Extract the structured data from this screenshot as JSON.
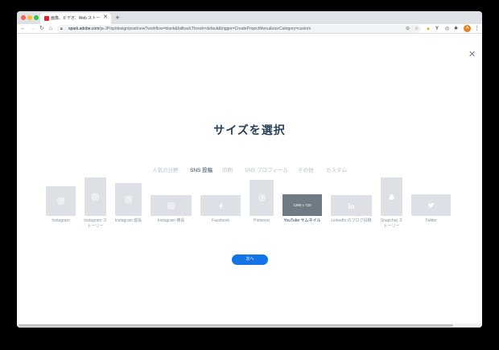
{
  "browser": {
    "tab_title": "画像、ビデオ、Web ストーリーを",
    "url_host": "spark.adobe.com",
    "url_path": "/ja-JP/sp/design/post/new?workflow=blank&fallbackThresh=default&trigger=CreateProjectMenu&sizeCategory=custom",
    "avatar_letter": "A"
  },
  "page": {
    "heading": "サイズを選択",
    "next_button": "次へ"
  },
  "tabs": [
    {
      "label": "人気の分野",
      "active": false
    },
    {
      "label": "SNS 投稿",
      "active": true
    },
    {
      "label": "印刷",
      "active": false
    },
    {
      "label": "SNS プロフィール",
      "active": false
    },
    {
      "label": "その他",
      "active": false
    },
    {
      "label": "カスタム",
      "active": false
    }
  ],
  "cards": [
    {
      "label": "Instagram",
      "icon": "instagram-icon",
      "selected": false
    },
    {
      "label": "Instagram ストーリー",
      "icon": "instagram-icon",
      "selected": false
    },
    {
      "label": "Instagram 縦長",
      "icon": "instagram-icon",
      "selected": false
    },
    {
      "label": "Instagram 横長",
      "icon": "instagram-icon",
      "selected": false
    },
    {
      "label": "Facebook",
      "icon": "facebook-icon",
      "selected": false
    },
    {
      "label": "Pinterest",
      "icon": "pinterest-icon",
      "selected": false
    },
    {
      "label": "YouTube サムネイル",
      "icon": "",
      "dimension": "1280 x 720",
      "selected": true
    },
    {
      "label": "LinkedIn のブログ投稿",
      "icon": "linkedin-icon",
      "selected": false
    },
    {
      "label": "Snapchat ストーリー",
      "icon": "snapchat-icon",
      "selected": false
    },
    {
      "label": "Twitter",
      "icon": "twitter-icon",
      "selected": false
    }
  ],
  "colors": {
    "heading": "#2c4057",
    "card": "#dde1e5",
    "card_selected": "#707a84",
    "primary_button": "#1473e6",
    "inactive_tab": "#b6bfc9"
  }
}
